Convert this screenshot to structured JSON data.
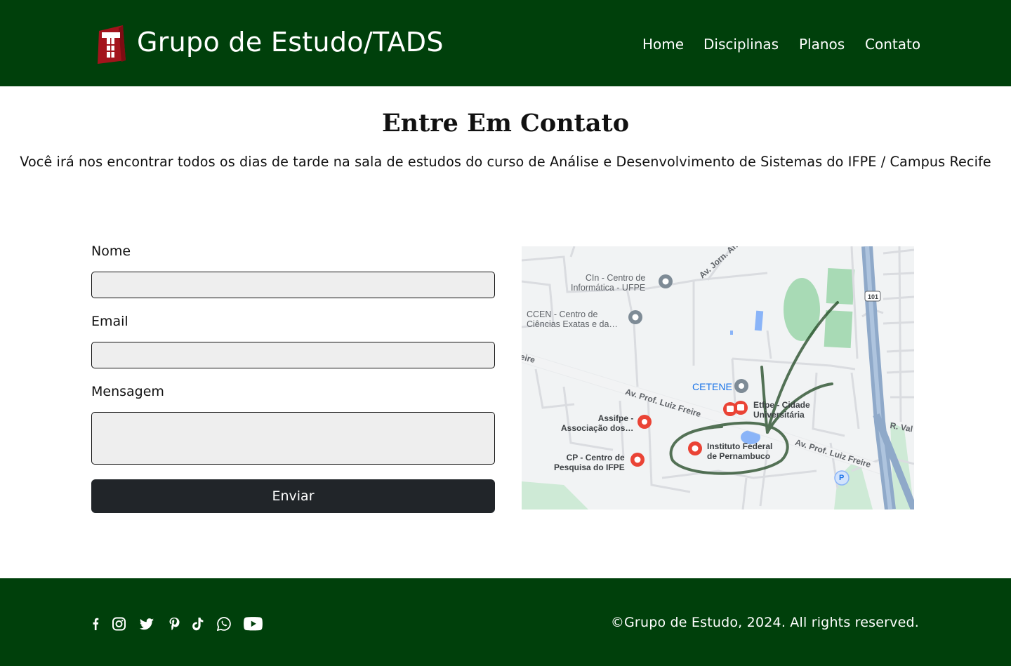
{
  "header": {
    "brand": "Grupo de Estudo/TADS",
    "logo_icon": "ifpe-t-logo-icon",
    "nav": [
      {
        "label": "Home"
      },
      {
        "label": "Disciplinas"
      },
      {
        "label": "Planos"
      },
      {
        "label": "Contato"
      }
    ]
  },
  "main": {
    "title": "Entre Em Contato",
    "subtitle": "Você irá nos encontrar todos os dias de tarde na sala de estudos do curso de Análise e Desenvolvimento de Sistemas do IFPE / Campus Recife"
  },
  "form": {
    "name_label": "Nome",
    "name_value": "",
    "email_label": "Email",
    "email_value": "",
    "message_label": "Mensagem",
    "message_value": "",
    "submit_label": "Enviar"
  },
  "map": {
    "places": {
      "cin": "CIn - Centro de\nInformática - UFPE",
      "ccen": "CCEN - Centro de\nCiências Exatas e da…",
      "cetene": "CETENE",
      "etfpe": "Etfpe - Cidade\nUniversitária",
      "assifpe": "Assifpe -\nAssociação dos…",
      "ifpe": "Instituto Federal\nde Pernambuco",
      "cp": "CP - Centro de\nPesquisa do IFPE"
    },
    "roads": {
      "jorn": "Av. Jorn. Aniba",
      "luiz_left": "Av. Prof. Luiz Freire",
      "luiz_right": "Av. Prof. Luiz Freire",
      "freire_edge": "eire",
      "val": "R. Val",
      "highway": "101",
      "parking": "P"
    }
  },
  "footer": {
    "social_icons": [
      "facebook-icon",
      "instagram-icon",
      "twitter-icon",
      "pinterest-icon",
      "tiktok-icon",
      "whatsapp-icon",
      "youtube-icon"
    ],
    "copyright": "©Grupo de Estudo, 2024. All rights reserved."
  },
  "colors": {
    "header_bg": "#00400b",
    "button_bg": "#212529",
    "input_bg": "#eeeeee"
  }
}
